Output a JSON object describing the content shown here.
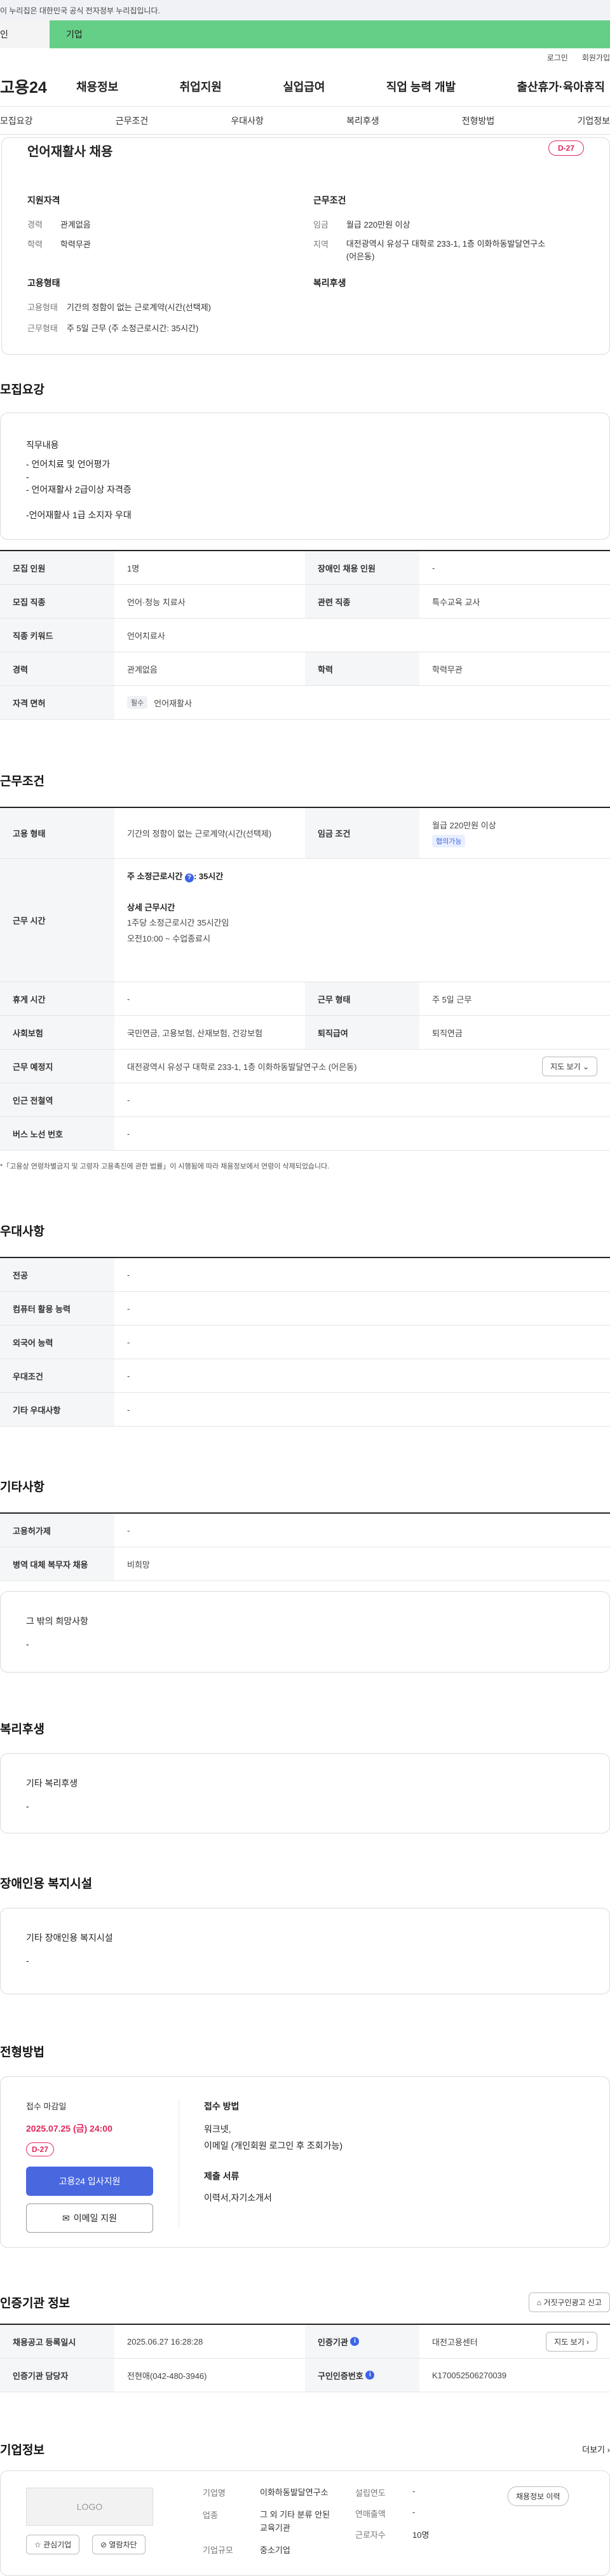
{
  "gov_bar": "이 누리집은 대한민국 공식 전자정부 누리집입니다.",
  "user_type": {
    "left": "인",
    "right": "기업"
  },
  "util": {
    "login": "로그인",
    "join": "회원가입"
  },
  "logo": "고용24",
  "gnb": [
    "채용정보",
    "취업지원",
    "실업급여",
    "직업 능력 개발",
    "출산휴가·육아휴직"
  ],
  "tabs": [
    "모집요강",
    "근무조건",
    "우대사항",
    "복리후생",
    "전형방법",
    "기업정보"
  ],
  "summary": {
    "title": "언어재활사 채용",
    "dday": "D-27",
    "req_title": "지원자격",
    "career_l": "경력",
    "career": "관계없음",
    "edu_l": "학력",
    "edu": "학력무관",
    "cond_title": "근무조건",
    "wage_l": "임금",
    "wage": "월급 220만원 이상",
    "loc_l": "지역",
    "loc": "대전광역시 유성구 대학로 233-1, 1층 이화하동발달연구소 (어은동)",
    "emp_title": "고용형태",
    "emp_type_l": "고용형태",
    "emp_type": "기간의 정함이 없는 근로계약(시간(선택제)",
    "work_type_l": "근무형태",
    "work_type": "주 5일 근무 (주 소정근로시간: 35시간)",
    "welfare_title": "복리후생"
  },
  "recruit": {
    "title": "모집요강",
    "duty_title": "직무내용",
    "duty_lines": [
      "- 언어치료 및 언어평가",
      "-",
      "- 언어재활사 2급이상 자격증",
      "",
      "-언어재활사 1급 소지자 우대"
    ],
    "rows": [
      {
        "k1": "모집 인원",
        "v1": "1명",
        "k2": "장애인 채용 인원",
        "v2": "-"
      },
      {
        "k1": "모집 직종",
        "v1": "언어·청능 치료사",
        "k2": "관련 직종",
        "v2": "특수교육 교사"
      },
      {
        "k1": "직종 키워드",
        "v1": "언어치료사"
      },
      {
        "k1": "경력",
        "v1": "관계없음",
        "k2": "학력",
        "v2": "학력무관"
      }
    ],
    "license_l": "자격 면허",
    "license_badge": "필수",
    "license": "언어재활사"
  },
  "cond": {
    "title": "근무조건",
    "emp_l": "고용 형태",
    "emp": "기간의 정함이 없는 근로계약(시간(선택제)",
    "wage_l": "임금 조건",
    "wage": "월급 220만원 이상",
    "wage_badge": "협의가능",
    "time_l": "근무 시간",
    "weekly": "주 소정근로시간",
    "weekly_hours": "35시간",
    "detail_title": "상세 근무시간",
    "detail1": "1주당 소정근로시간 35시간임",
    "detail2": "오전10:00 ~ 수업종료시",
    "rest_l": "휴게 시간",
    "rest": "-",
    "wform_l": "근무 형태",
    "wform": "주 5일 근무",
    "ins_l": "사회보험",
    "ins": "국민연금, 고용보험, 산재보험, 건강보험",
    "ret_l": "퇴직급여",
    "ret": "퇴직연금",
    "place_l": "근무 예정지",
    "place": "대전광역시 유성구 대학로 233-1, 1층 이화하동발달연구소 (어은동)",
    "map_btn": "지도 보기",
    "subway_l": "인근 전철역",
    "subway": "-",
    "bus_l": "버스 노선 번호",
    "bus": "-",
    "note": "*「고용상 연령차별금지 및 고령자 고용촉진에 관한 법률」이 시행됨에 따라 채용정보에서 연령이 삭제되었습니다."
  },
  "pref": {
    "title": "우대사항",
    "rows": [
      {
        "k": "전공",
        "v": "-"
      },
      {
        "k": "컴퓨터 활용 능력",
        "v": "-"
      },
      {
        "k": "외국어 능력",
        "v": "-"
      },
      {
        "k": "우대조건",
        "v": "-"
      },
      {
        "k": "기타 우대사항",
        "v": "-"
      }
    ]
  },
  "etc": {
    "title": "기타사항",
    "rows": [
      {
        "k": "고용허가제",
        "v": "-"
      },
      {
        "k": "병역 대체 복무자 채용",
        "v": "비희망"
      }
    ],
    "box_title": "그 밖의 희망사항",
    "box_val": "-"
  },
  "welfare": {
    "title": "복리후생",
    "box_title": "기타 복리후생",
    "box_val": "-"
  },
  "disab": {
    "title": "장애인용 복지시설",
    "box_title": "기타 장애인용 복지시설",
    "box_val": "-"
  },
  "apply": {
    "title": "전형방법",
    "deadline_l": "접수 마감일",
    "deadline": "2025.07.25 (금) 24:00",
    "dday": "D-27",
    "apply_btn": "고용24 입사지원",
    "email_btn": "이메일 지원",
    "method_l": "접수 방법",
    "method1": "워크넷,",
    "method2": "이메일 (개인회원 로그인 후 조회가능)",
    "docs_l": "제출 서류",
    "docs": "이력서,자기소개서"
  },
  "cert": {
    "title": "인증기관 정보",
    "report_btn": "거짓구인광고 신고",
    "reg_l": "채용공고 등록일시",
    "reg": "2025.06.27 16:28:28",
    "org_l": "인증기관",
    "org": "대전고용센터",
    "map_btn": "지도 보기",
    "mgr_l": "인증기관 담당자",
    "mgr": "전현애(042-480-3946)",
    "num_l": "구인인증번호",
    "num": "K170052506270039"
  },
  "company": {
    "title": "기업정보",
    "more": "더보기",
    "logo": "LOGO",
    "fav_btn": "관심기업",
    "block_btn": "열람차단",
    "name_l": "기업명",
    "name": "이화하동발달연구소",
    "est_l": "설립연도",
    "est": "-",
    "sales_l": "연매출액",
    "sales": "-",
    "ind_l": "업종",
    "ind": "그 외 기타 분류 안된 교육기관",
    "emp_l": "근로자수",
    "emp": "10명",
    "size_l": "기업규모",
    "size": "중소기업",
    "jobs_btn": "채용정보 이력"
  }
}
